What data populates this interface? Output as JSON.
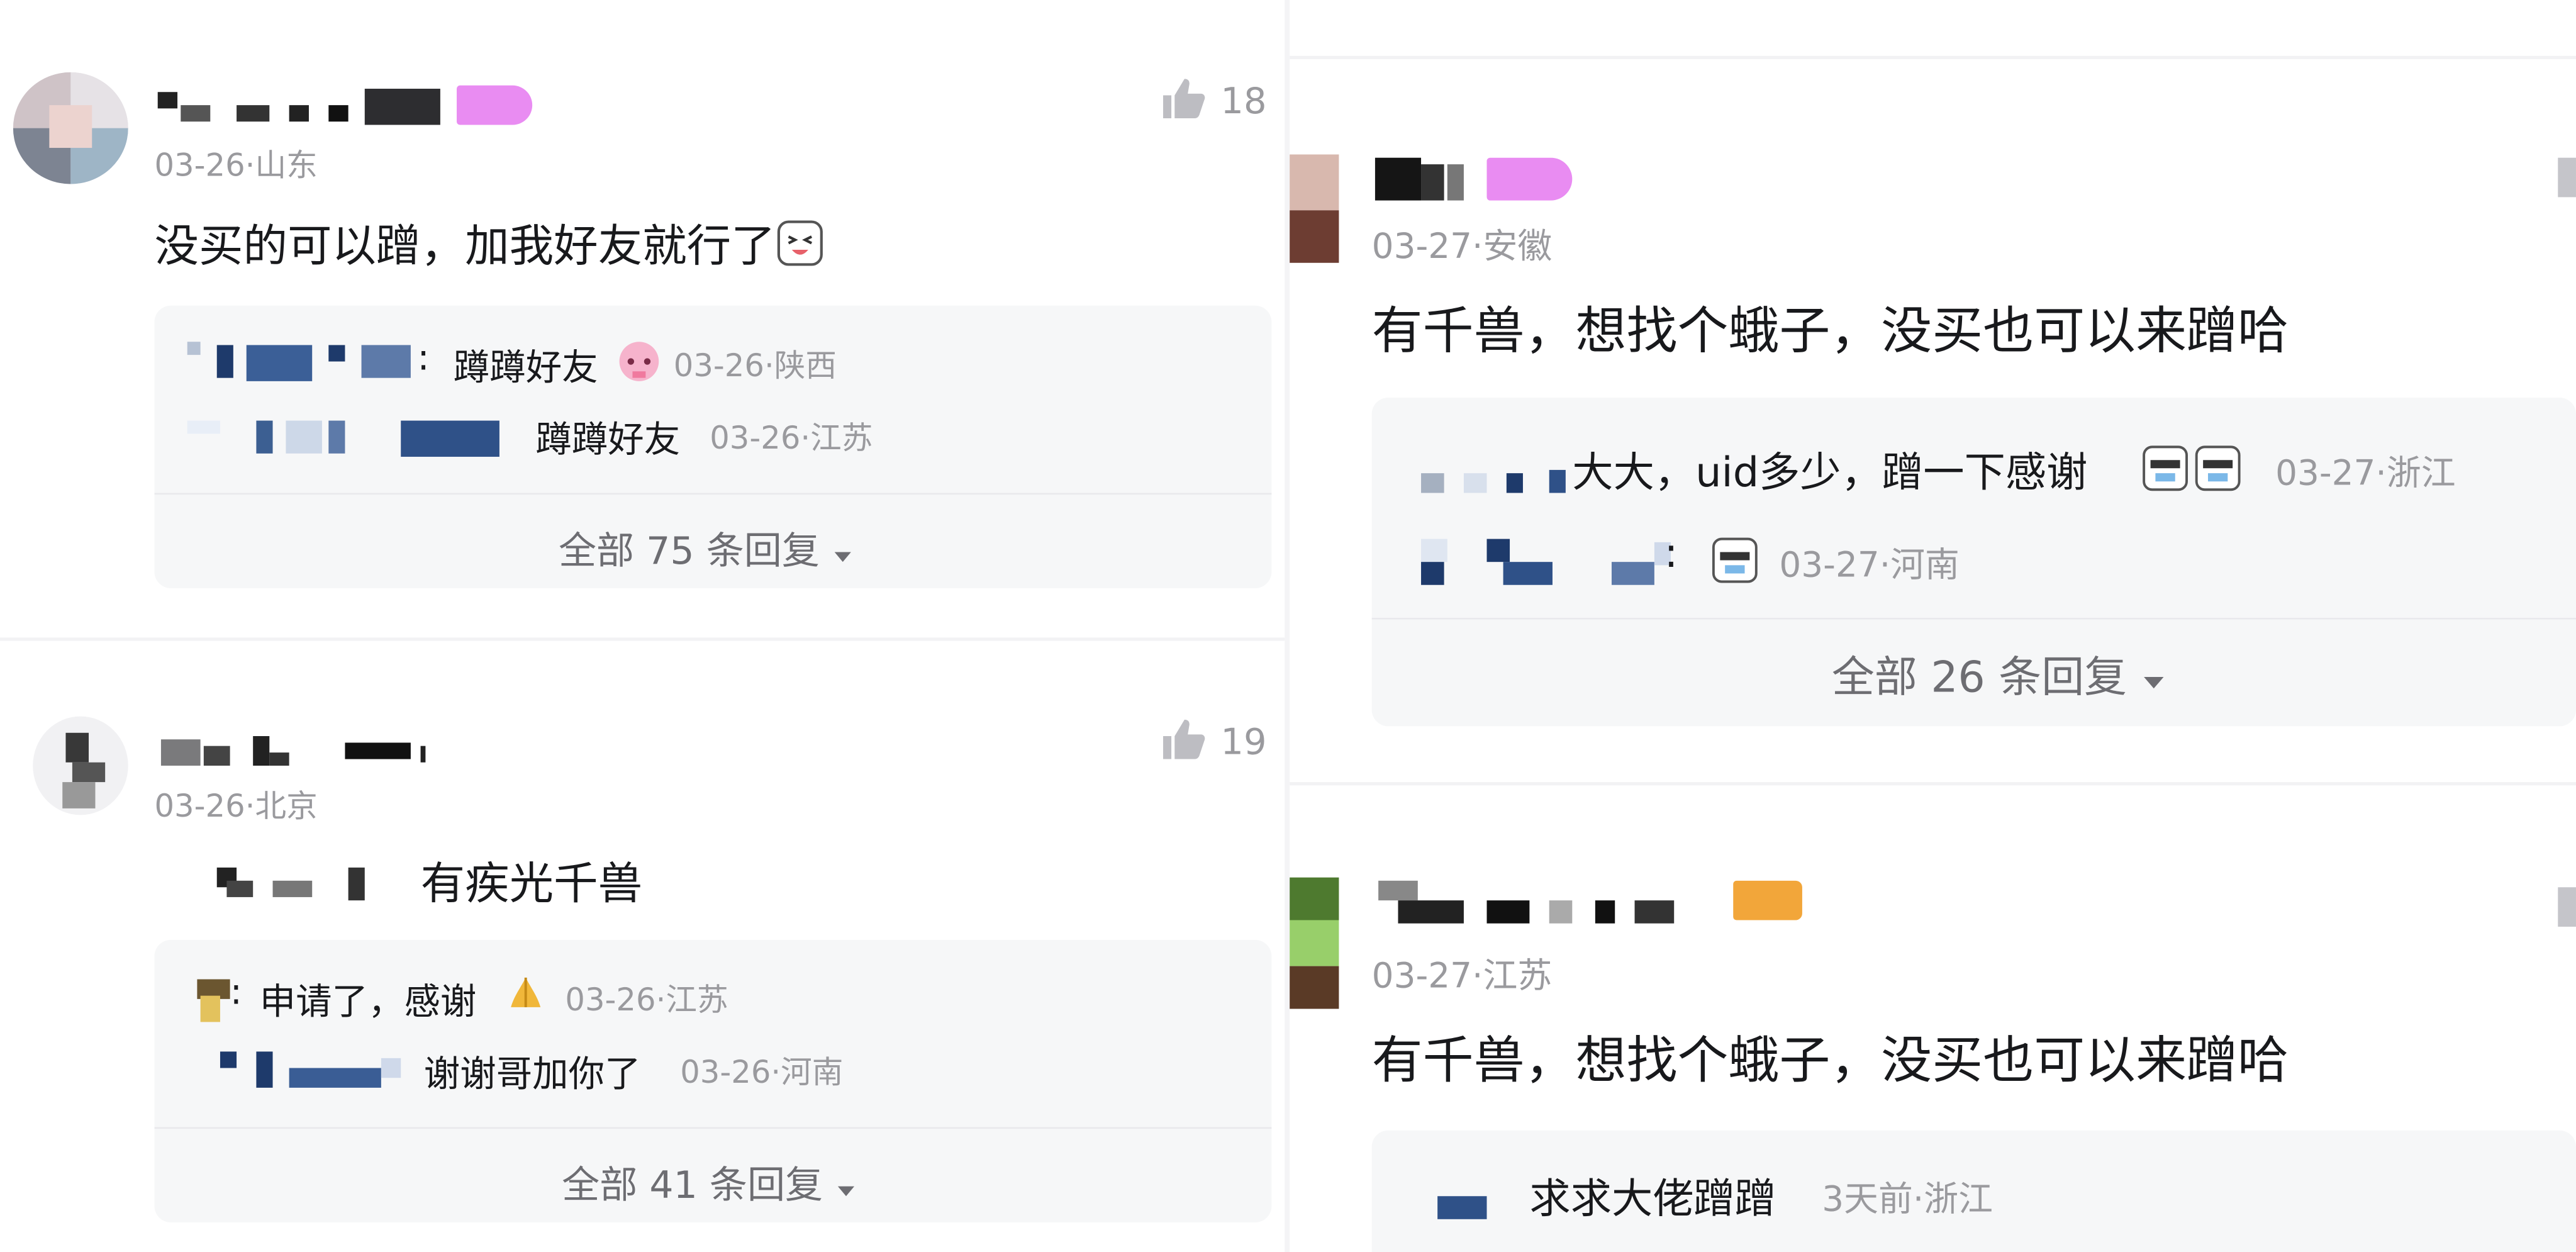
{
  "left_column": [
    {
      "meta": "03-26·山东",
      "likes": "18",
      "content": "没买的可以蹭，加我好友就行了",
      "replies": [
        {
          "text": "蹲蹲好友",
          "meta": "03-26·陕西"
        },
        {
          "text": "蹲蹲好友",
          "meta": "03-26·江苏"
        }
      ],
      "all_replies": "全部 75 条回复"
    },
    {
      "meta": "03-26·北京",
      "likes": "19",
      "content": "有疾光千兽",
      "replies": [
        {
          "text": "申请了，感谢",
          "meta": "03-26·江苏"
        },
        {
          "text": "谢谢哥加你了",
          "meta": "03-26·河南"
        }
      ],
      "all_replies": "全部 41 条回复"
    }
  ],
  "right_column": [
    {
      "meta": "03-27·安徽",
      "content": "有千兽，想找个蛾子，没买也可以来蹭哈",
      "replies": [
        {
          "text": "大大，uid多少，蹭一下感谢",
          "meta": "03-27·浙江"
        },
        {
          "text": "",
          "meta": "03-27·河南"
        }
      ],
      "all_replies": "全部 26 条回复"
    },
    {
      "meta": "03-27·江苏",
      "content": "有千兽，想找个蛾子，没买也可以来蹭哈",
      "replies": [
        {
          "text": "求求大佬蹭蹭",
          "meta": "3天前·浙江"
        }
      ]
    }
  ],
  "colors": {
    "text": "#18191c",
    "meta": "#9a9a9e",
    "reply_bg": "#f6f7f8",
    "badge_pink": "#e98cf2",
    "badge_orange": "#f2a63a"
  },
  "icons": [
    "thumb-up-icon",
    "caret-down-icon",
    "emoji-icon"
  ]
}
